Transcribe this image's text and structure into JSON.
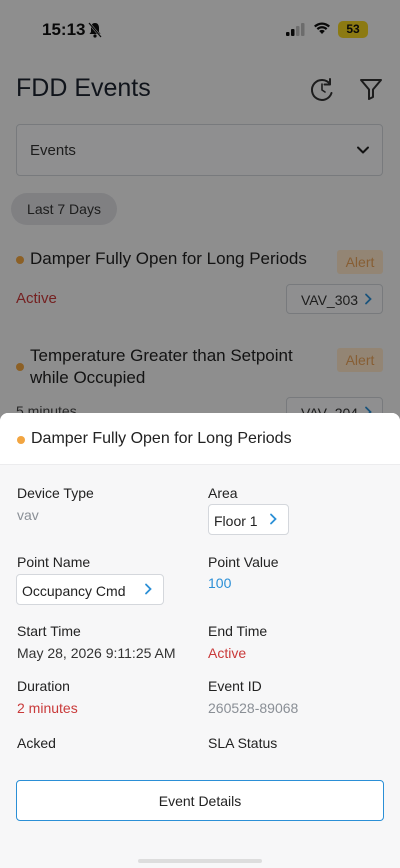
{
  "status_bar": {
    "time": "15:13",
    "battery": "53"
  },
  "header": {
    "title": "FDD Events"
  },
  "filter": {
    "selected": "Events"
  },
  "date_chip": "Last 7 Days",
  "events": [
    {
      "title": "Damper Fully Open for Long Periods",
      "badge": "Alert",
      "status": "Active",
      "device": "VAV_303"
    },
    {
      "title_line1": "Temperature Greater than Setpoint",
      "title_line2": "while Occupied",
      "badge": "Alert",
      "status": "5 minutes",
      "device": "VAV_204"
    }
  ],
  "sheet": {
    "title": "Damper Fully Open for Long Periods",
    "device_type_label": "Device Type",
    "device_type_value": "vav",
    "area_label": "Area",
    "area_value": "Floor 1",
    "point_name_label": "Point Name",
    "point_name_value": "Occupancy Cmd",
    "point_value_label": "Point Value",
    "point_value_value": "100",
    "start_time_label": "Start Time",
    "start_time_value": "May 28, 2026 9:11:25 AM",
    "end_time_label": "End Time",
    "end_time_value": "Active",
    "duration_label": "Duration",
    "duration_value": "2 minutes",
    "event_id_label": "Event ID",
    "event_id_value": "260528-89068",
    "acked_label": "Acked",
    "sla_status_label": "SLA Status",
    "details_button": "Event Details"
  },
  "colors": {
    "accent": "#2b8fd6",
    "alert_dot": "#f2a541",
    "active_red": "#c93a3a"
  }
}
